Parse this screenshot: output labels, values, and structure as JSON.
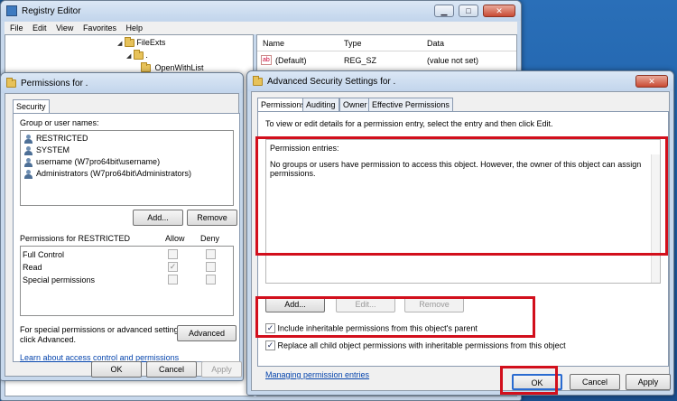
{
  "registry": {
    "title": "Registry Editor",
    "menu": [
      "File",
      "Edit",
      "View",
      "Favorites",
      "Help"
    ],
    "tree": [
      "FileExts",
      ".",
      "OpenWithList"
    ],
    "columns": [
      "Name",
      "Type",
      "Data"
    ],
    "row": {
      "name": "(Default)",
      "type": "REG_SZ",
      "data": "(value not set)"
    }
  },
  "perm": {
    "title": "Permissions for .",
    "tab": "Security",
    "group_label": "Group or user names:",
    "users": [
      "RESTRICTED",
      "SYSTEM",
      "username (W7pro64bit\\username)",
      "Administrators (W7pro64bit\\Administrators)"
    ],
    "add_label": "Add...",
    "remove_label": "Remove",
    "perms_for": "Permissions for RESTRICTED",
    "allow_label": "Allow",
    "deny_label": "Deny",
    "perm_rows": [
      {
        "name": "Full Control",
        "allow": "",
        "deny": ""
      },
      {
        "name": "Read",
        "allow": "✓",
        "deny": ""
      },
      {
        "name": "Special permissions",
        "allow": "",
        "deny": ""
      }
    ],
    "special_text_1": "For special permissions or advanced settings,",
    "special_text_2": "click Advanced.",
    "advanced_label": "Advanced",
    "learn_link": "Learn about access control and permissions",
    "ok_label": "OK",
    "cancel_label": "Cancel",
    "apply_label": "Apply"
  },
  "adv": {
    "title": "Advanced Security Settings for .",
    "tabs": [
      "Permissions",
      "Auditing",
      "Owner",
      "Effective Permissions"
    ],
    "intro": "To view or edit details for a permission entry, select the entry and then click Edit.",
    "entries_label": "Permission entries:",
    "entries_msg": "No groups or users have permission to access this object. However, the owner of this object can assign permissions.",
    "add_label": "Add...",
    "edit_label": "Edit...",
    "remove_label": "Remove",
    "include_label": "Include inheritable permissions from this object's parent",
    "replace_label": "Replace all child object permissions with inheritable permissions from this object",
    "include_mark": "✓",
    "replace_mark": "✓",
    "manage_link": "Managing permission entries",
    "ok_label": "OK",
    "cancel_label": "Cancel",
    "apply_label": "Apply"
  },
  "window_controls": {
    "minimize": "▁",
    "maximize": "□",
    "close": "✕"
  },
  "colors": {
    "highlight_red": "#d20f1c",
    "link_blue": "#0645ad"
  }
}
